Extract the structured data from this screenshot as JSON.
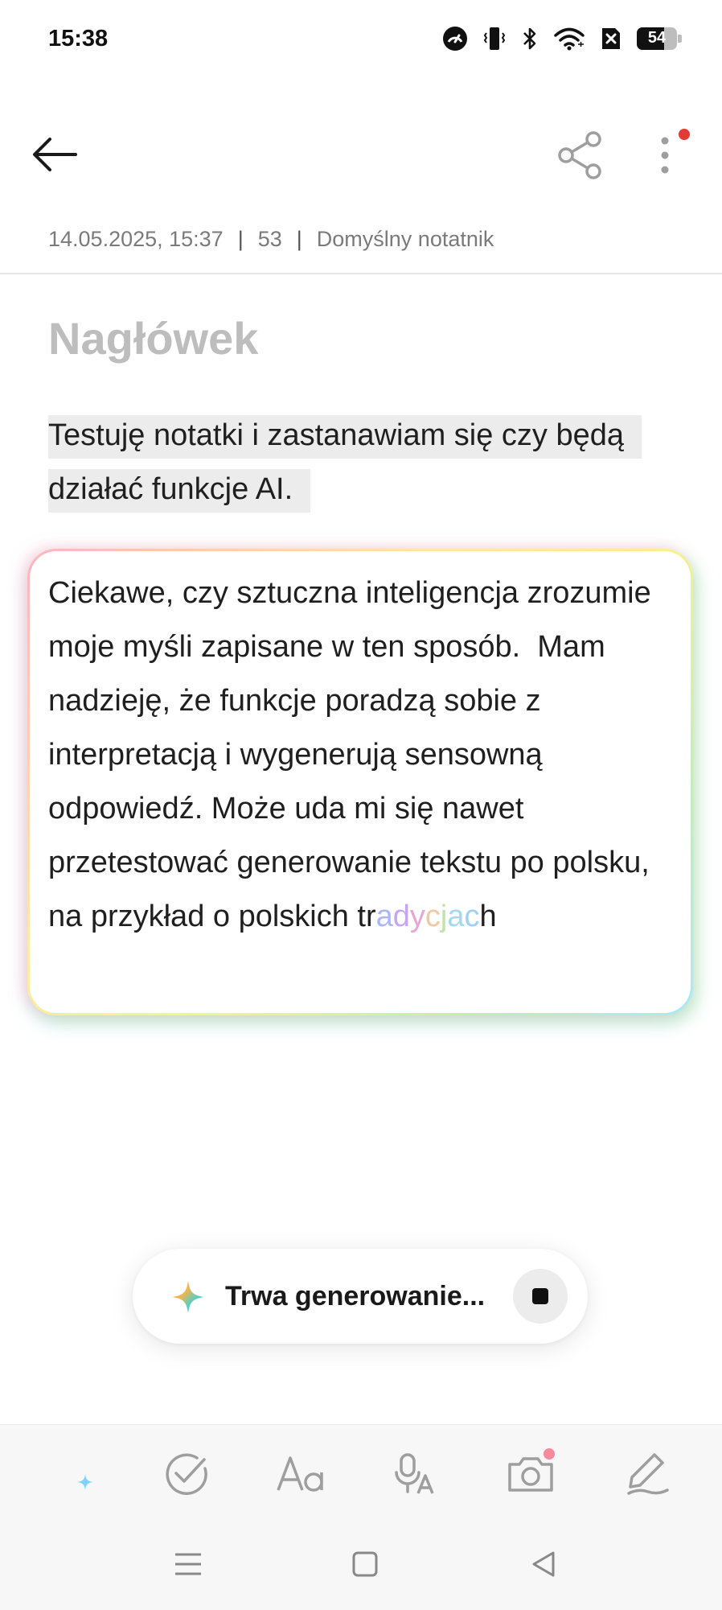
{
  "status_bar": {
    "time": "15:38",
    "battery": "54",
    "icons": [
      "speedometer-icon",
      "vibrate-icon",
      "bluetooth-icon",
      "wifi-icon",
      "sim-x-icon",
      "battery-icon"
    ]
  },
  "header": {
    "back_icon": "arrow-left-icon",
    "share_icon": "share-icon",
    "more_icon": "more-vertical-icon"
  },
  "meta": {
    "datetime": "14.05.2025, 15:37",
    "separator": "|",
    "char_count": "53",
    "notebook": "Domyślny notatnik"
  },
  "note": {
    "heading_placeholder": "Nagłówek",
    "body": "Testuję notatki i zastanawiam się czy będą działać funkcje AI."
  },
  "ai_result": {
    "text_main": "Ciekawe, czy sztuczna inteligencja zrozumie moje myśli zapisane w ten sposób.  Mam nadzieję, że funkcje poradzą sobie z interpretacją i wygenerują sensowną odpowiedź. Może uda mi się nawet przetestować generowanie tekstu po polsku, na przykład o polskich tr",
    "text_fading": "adycjach"
  },
  "generation": {
    "label": "Trwa generowanie...",
    "stop_icon": "stop-icon"
  },
  "toolbar": {
    "items": [
      "ai-assist-icon",
      "checklist-icon",
      "text-format-icon",
      "voice-to-text-icon",
      "camera-icon",
      "pen-icon"
    ]
  },
  "navigation": [
    "menu-icon",
    "home-icon",
    "back-triangle-icon"
  ],
  "colors": {
    "accent_red": "#e53935",
    "toolbar_bg": "#f7f7f7",
    "icon_gray": "#9e9e9e"
  }
}
